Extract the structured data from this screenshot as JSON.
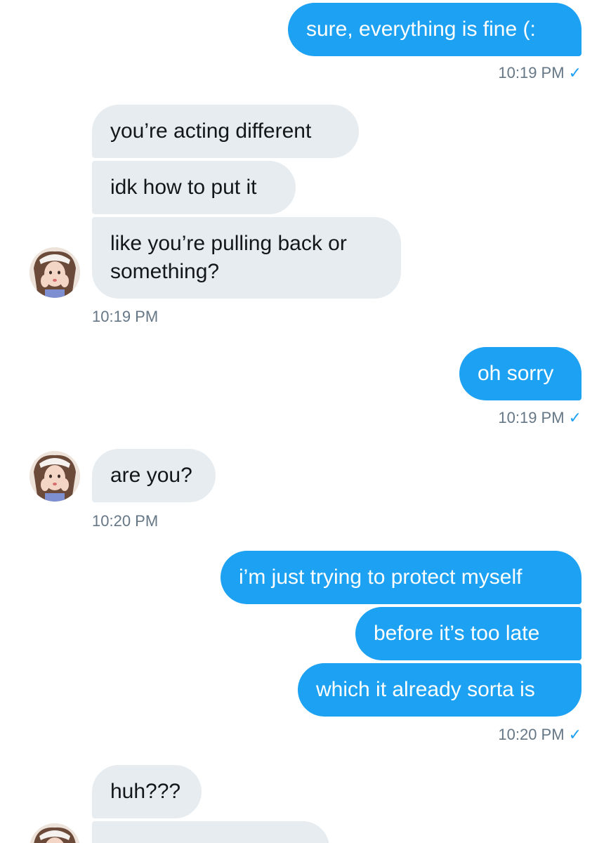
{
  "conversation": {
    "msg1": {
      "text": "sure, everything is fine (:"
    },
    "time1": {
      "text": "10:19 PM",
      "check": "✓"
    },
    "msg2": {
      "text": "you’re acting different"
    },
    "msg3": {
      "text": "idk how to put it"
    },
    "msg4": {
      "text": "like you’re pulling back or\nsomething?"
    },
    "time2": {
      "text": "10:19 PM"
    },
    "msg5": {
      "text": "oh sorry"
    },
    "time3": {
      "text": "10:19 PM",
      "check": "✓"
    },
    "msg6": {
      "text": "are you?"
    },
    "time4": {
      "text": "10:20 PM"
    },
    "msg7": {
      "text": "i’m just trying to protect myself"
    },
    "msg8": {
      "text": "before it’s too late"
    },
    "msg9": {
      "text": "which it already sorta is"
    },
    "time5": {
      "text": "10:20 PM",
      "check": "✓"
    },
    "msg10": {
      "text": "huh???"
    }
  },
  "colors": {
    "sent_bubble": "#1DA1F2",
    "received_bubble": "#E6ECF0",
    "timestamp": "#657786",
    "read_check": "#1DA1F2"
  },
  "icons": {
    "avatar": "user-avatar-photo",
    "read_receipt": "checkmark-icon"
  }
}
